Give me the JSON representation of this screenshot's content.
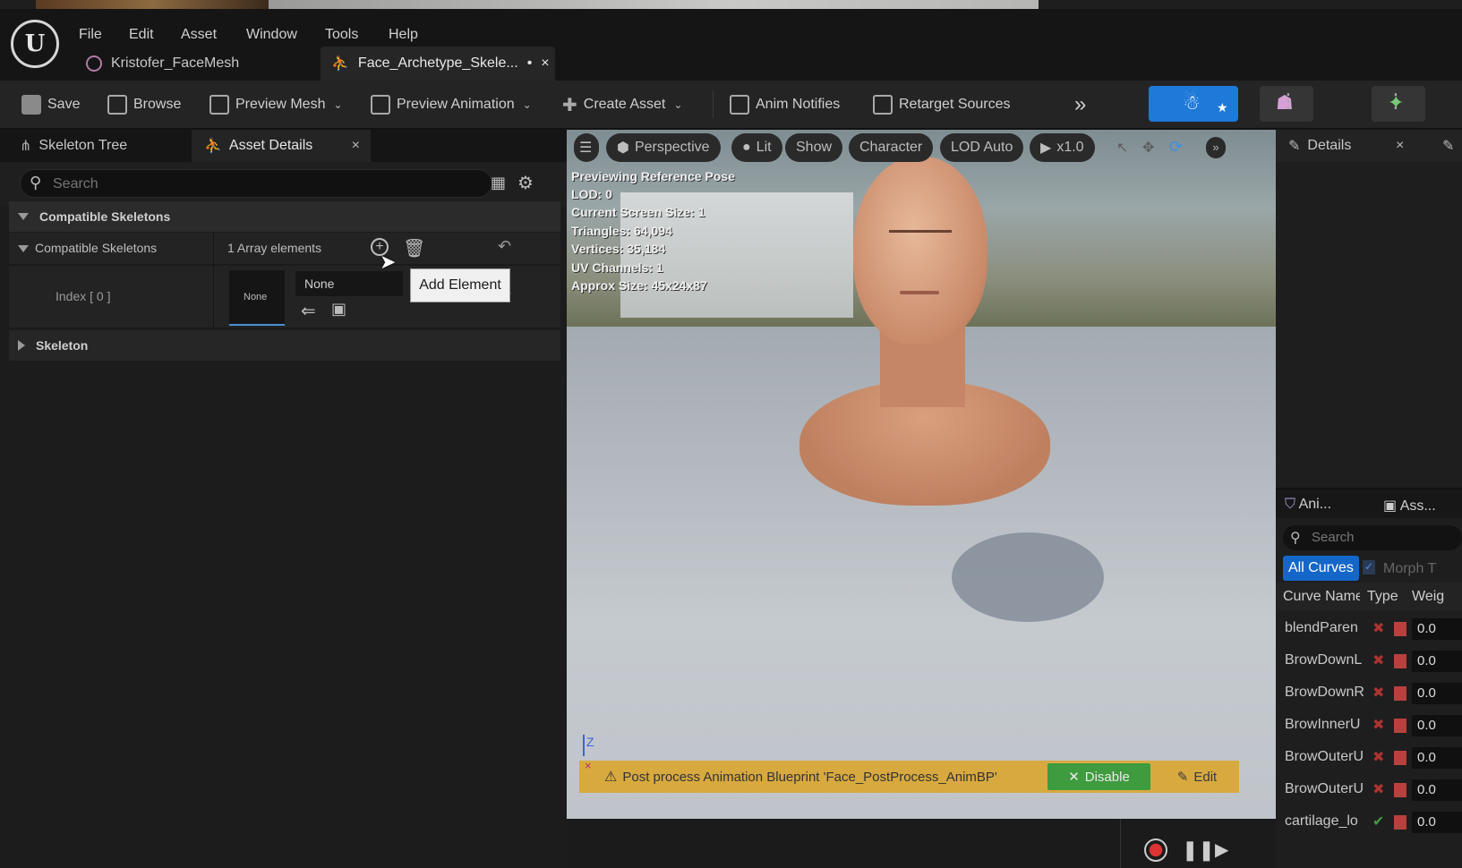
{
  "menu": [
    "File",
    "Edit",
    "Asset",
    "Window",
    "Tools",
    "Help"
  ],
  "doc_tabs": [
    {
      "label": "Kristofer_FaceMesh"
    },
    {
      "label": "Face_Archetype_Skele...",
      "dirty": "•",
      "close": "×"
    }
  ],
  "toolbar": {
    "save": "Save",
    "browse": "Browse",
    "preview_mesh": "Preview Mesh",
    "preview_animation": "Preview Animation",
    "create_asset": "Create Asset",
    "anim_notifies": "Anim Notifies",
    "retarget_sources": "Retarget Sources",
    "more": "»"
  },
  "left_panel": {
    "tabs": [
      "Skeleton Tree",
      "Asset Details"
    ],
    "search_placeholder": "Search",
    "category": "Compatible Skeletons",
    "array_label": "Compatible Skeletons",
    "array_count": "1 Array elements",
    "index_label": "Index [ 0 ]",
    "thumb_none": "None",
    "combo_value": "None",
    "skeleton_category": "Skeleton"
  },
  "tooltip": "Add Element",
  "viewport": {
    "pills": [
      "Perspective",
      "Lit",
      "Show",
      "Character",
      "LOD Auto",
      "x1.0"
    ],
    "stats": [
      "Previewing Reference Pose",
      "LOD: 0",
      "Current Screen Size: 1",
      "Triangles: 64,094",
      "Vertices: 35,184",
      "UV Channels: 1",
      "Approx Size: 45x24x87"
    ],
    "axis_label": "Z",
    "warning": "Post process Animation Blueprint 'Face_PostProcess_AnimBP'",
    "disable": "Disable",
    "edit": "Edit"
  },
  "right_panel": {
    "details_tab": "Details",
    "lower_tabs": [
      "Ani...",
      "Ass..."
    ],
    "search_placeholder": "Search",
    "filter_all": "All Curves",
    "filter_morph": "Morph T",
    "columns": [
      "Curve Name",
      "Type",
      "Weig"
    ],
    "curves": [
      {
        "name": "blendParen",
        "value": "0.0"
      },
      {
        "name": "BrowDownL",
        "value": "0.0"
      },
      {
        "name": "BrowDownR",
        "value": "0.0"
      },
      {
        "name": "BrowInnerU",
        "value": "0.0"
      },
      {
        "name": "BrowOuterU",
        "value": "0.0"
      },
      {
        "name": "BrowOuterU",
        "value": "0.0"
      },
      {
        "name": "cartilage_lo",
        "value": "0.0"
      }
    ]
  },
  "colors": {
    "accent": "#1e79d9",
    "warning": "#d8a93f",
    "disable_green": "#3e9b3e",
    "filter_blue": "#1467c9"
  }
}
